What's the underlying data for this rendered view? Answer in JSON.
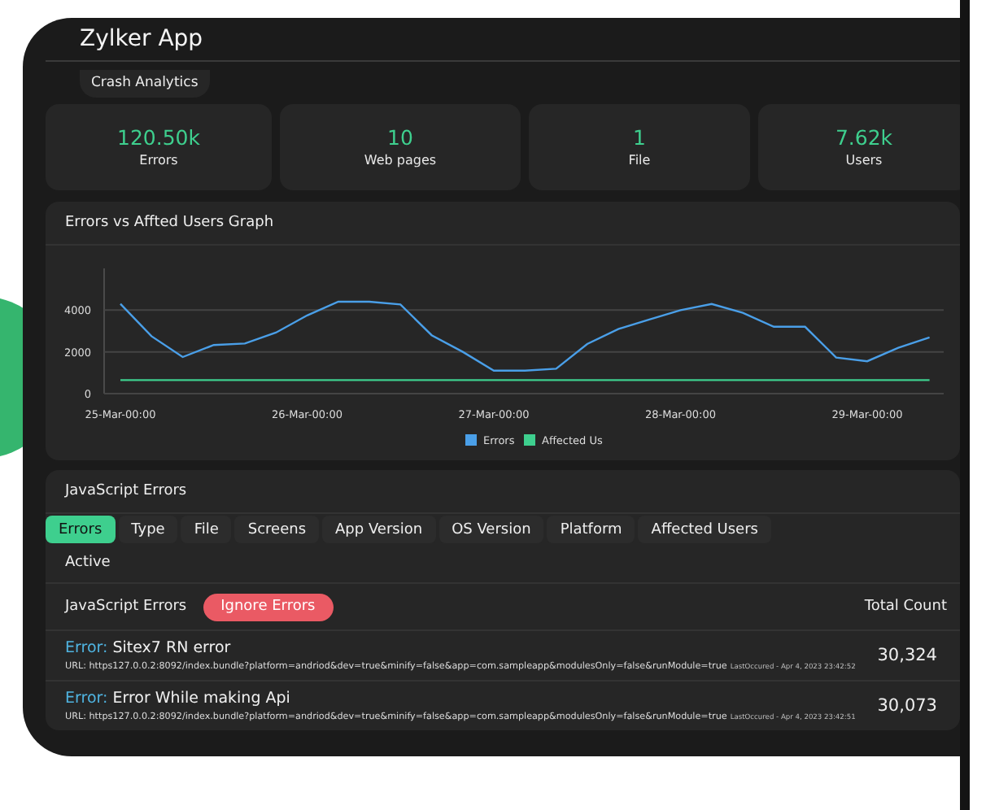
{
  "window": {
    "title": "Zylker App"
  },
  "section_tab": {
    "label": "Crash Analytics"
  },
  "stats": [
    {
      "value": "120.50k",
      "label": "Errors"
    },
    {
      "value": "10",
      "label": "Web pages"
    },
    {
      "value": "1",
      "label": "File"
    },
    {
      "value": "7.62k",
      "label": "Users"
    }
  ],
  "graph": {
    "title": "Errors vs Affted Users Graph",
    "chart_data": {
      "type": "line",
      "categories": [
        "25-Mar-00:00",
        null,
        null,
        null,
        null,
        null,
        "26-Mar-00:00",
        null,
        null,
        null,
        null,
        null,
        "27-Mar-00:00",
        null,
        null,
        null,
        null,
        null,
        "28-Mar-00:00",
        null,
        null,
        null,
        null,
        null,
        "29-Mar-00:00",
        null,
        null
      ],
      "series": [
        {
          "name": "Errors",
          "color": "#4a9fe8",
          "values": [
            4300,
            2750,
            1750,
            2330,
            2400,
            2920,
            3750,
            4400,
            4400,
            4270,
            2800,
            2000,
            1100,
            1100,
            1190,
            2380,
            3090,
            3550,
            4000,
            4290,
            3870,
            3200,
            3200,
            1730,
            1550,
            2200,
            2700
          ]
        },
        {
          "name": "Affected Us",
          "color": "#3ecf8e",
          "values": [
            650,
            650,
            650,
            650,
            650,
            650,
            650,
            650,
            650,
            650,
            650,
            650,
            650,
            650,
            650,
            650,
            650,
            650,
            650,
            650,
            650,
            650,
            650,
            650,
            650,
            650,
            650
          ]
        }
      ],
      "legend": "bottom",
      "ylim": [
        0,
        6000
      ],
      "yticks": [
        0,
        2000,
        4000
      ]
    }
  },
  "errors_panel": {
    "title": "JavaScript Errors",
    "tabs": [
      {
        "label": "Errors",
        "selected": true
      },
      {
        "label": "Type",
        "selected": false
      },
      {
        "label": "File",
        "selected": false
      },
      {
        "label": "Screens",
        "selected": false
      },
      {
        "label": "App Version",
        "selected": false
      },
      {
        "label": "OS Version",
        "selected": false
      },
      {
        "label": "Platform",
        "selected": false
      },
      {
        "label": "Affected Users",
        "selected": false
      }
    ],
    "filter": "Active",
    "header": {
      "label": "JavaScript Errors",
      "button": "Ignore Errors",
      "count_label": "Total Count"
    },
    "rows": [
      {
        "prefix": "Error:",
        "message": "Sitex7 RN error",
        "url": "URL: https127.0.0.2:8092/index.bundle?platform=andriod&dev=true&minify=false&app=com.sampleapp&modulesOnly=false&runModule=true",
        "last": "LastOccured - Apr 4, 2023 23:42:52",
        "count": "30,324"
      },
      {
        "prefix": "Error:",
        "message": "Error While making Api",
        "url": "URL: https127.0.0.2:8092/index.bundle?platform=andriod&dev=true&minify=false&app=com.sampleapp&modulesOnly=false&runModule=true",
        "last": "LastOccured - Apr 4, 2023 23:42:51",
        "count": "30,073"
      }
    ]
  }
}
